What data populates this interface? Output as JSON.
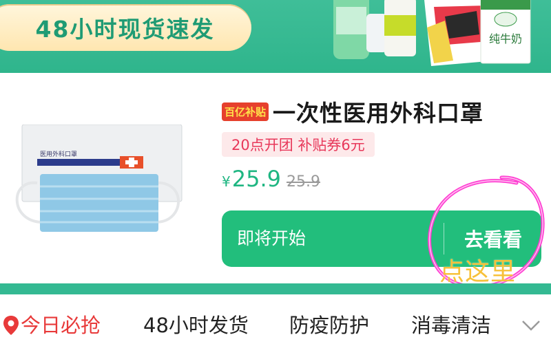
{
  "banner": {
    "title": "48小时现货速发",
    "milk_label": "纯牛奶"
  },
  "product": {
    "badge": "百亿补贴",
    "title": "一次性医用外科口罩",
    "tag": "20点开团 补贴券6元",
    "currency": "¥",
    "price": "25.9",
    "original_price": "25.9",
    "package_label": "医用外科口罩"
  },
  "action": {
    "status": "即将开始",
    "go_label": "去看看"
  },
  "annotation": {
    "text": "点这里"
  },
  "categories": {
    "items": [
      {
        "label": "今日必抢",
        "active": true
      },
      {
        "label": "48小时发货",
        "active": false
      },
      {
        "label": "防疫防护",
        "active": false
      },
      {
        "label": "消毒清洁",
        "active": false
      }
    ]
  },
  "colors": {
    "brand_green": "#22be7c",
    "accent_red": "#e83a3a",
    "annotation_magenta": "#ff3fd2",
    "annotation_yellow": "#f7c13a"
  },
  "icons": {
    "location": "location-pin-icon",
    "expand": "chevron-down-icon"
  }
}
